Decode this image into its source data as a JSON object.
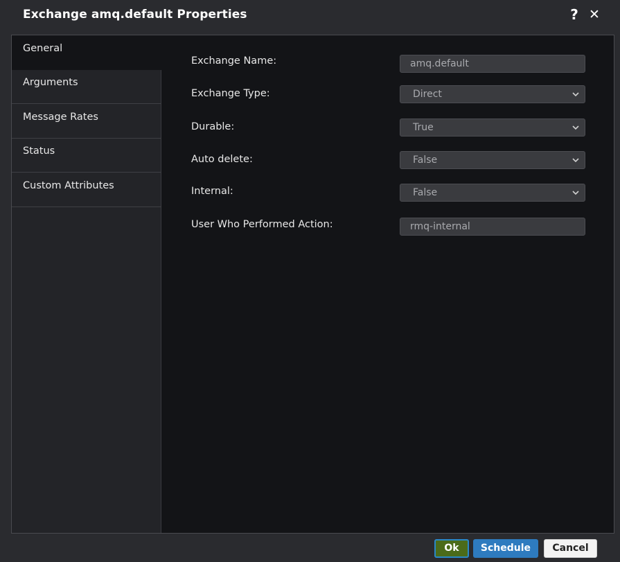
{
  "dialog": {
    "title": "Exchange amq.default Properties",
    "help_label": "?",
    "close_label": "✕"
  },
  "tabs": [
    {
      "label": "General",
      "active": true
    },
    {
      "label": "Arguments",
      "active": false
    },
    {
      "label": "Message Rates",
      "active": false
    },
    {
      "label": "Status",
      "active": false
    },
    {
      "label": "Custom Attributes",
      "active": false
    }
  ],
  "form": {
    "exchange_name": {
      "label": "Exchange Name:",
      "value": "amq.default"
    },
    "exchange_type": {
      "label": "Exchange Type:",
      "value": "Direct"
    },
    "durable": {
      "label": "Durable:",
      "value": "True"
    },
    "auto_delete": {
      "label": "Auto delete:",
      "value": "False"
    },
    "internal": {
      "label": "Internal:",
      "value": "False"
    },
    "user": {
      "label": "User Who Performed Action:",
      "value": "rmq-internal"
    }
  },
  "footer": {
    "ok_label": "Ok",
    "schedule_label": "Schedule",
    "cancel_label": "Cancel"
  },
  "colors": {
    "ok_button": "#4b6b1a",
    "schedule_button": "#2e7bbf",
    "cancel_button": "#f3f3f3",
    "dialog_bg": "#2a2b2f",
    "content_bg": "#131417"
  }
}
